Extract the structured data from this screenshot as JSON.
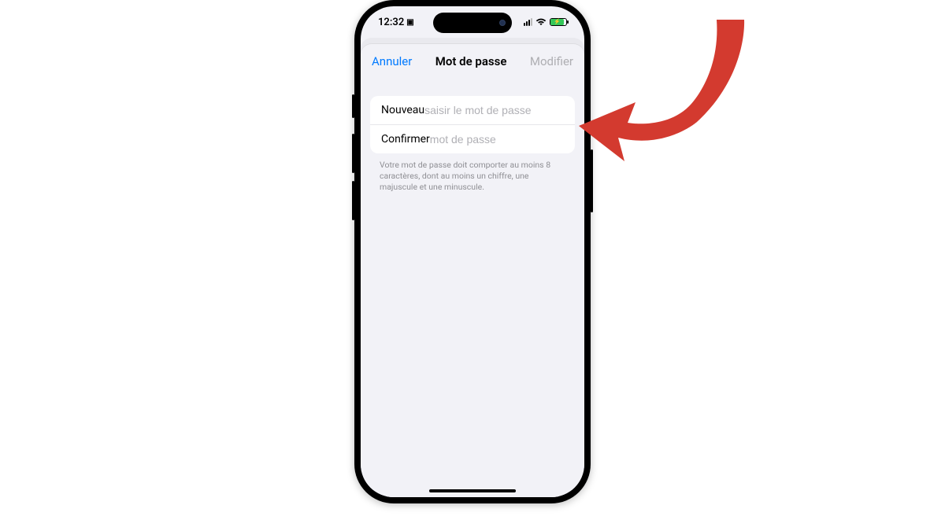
{
  "status_bar": {
    "time": "12:32",
    "shortcuts_icon": "arrow-up-icon"
  },
  "nav": {
    "cancel_label": "Annuler",
    "title": "Mot de passe",
    "action_label": "Modifier",
    "action_enabled": false
  },
  "form": {
    "new": {
      "label": "Nouveau",
      "placeholder": "saisir le mot de passe",
      "value": ""
    },
    "confirm": {
      "label": "Confirmer",
      "placeholder": "mot de passe",
      "value": ""
    },
    "hint": "Votre mot de passe doit comporter au moins 8 caractères, dont au moins un chiffre, une majuscule et une minuscule."
  },
  "annotation": {
    "arrow_color": "#d33a2f"
  }
}
